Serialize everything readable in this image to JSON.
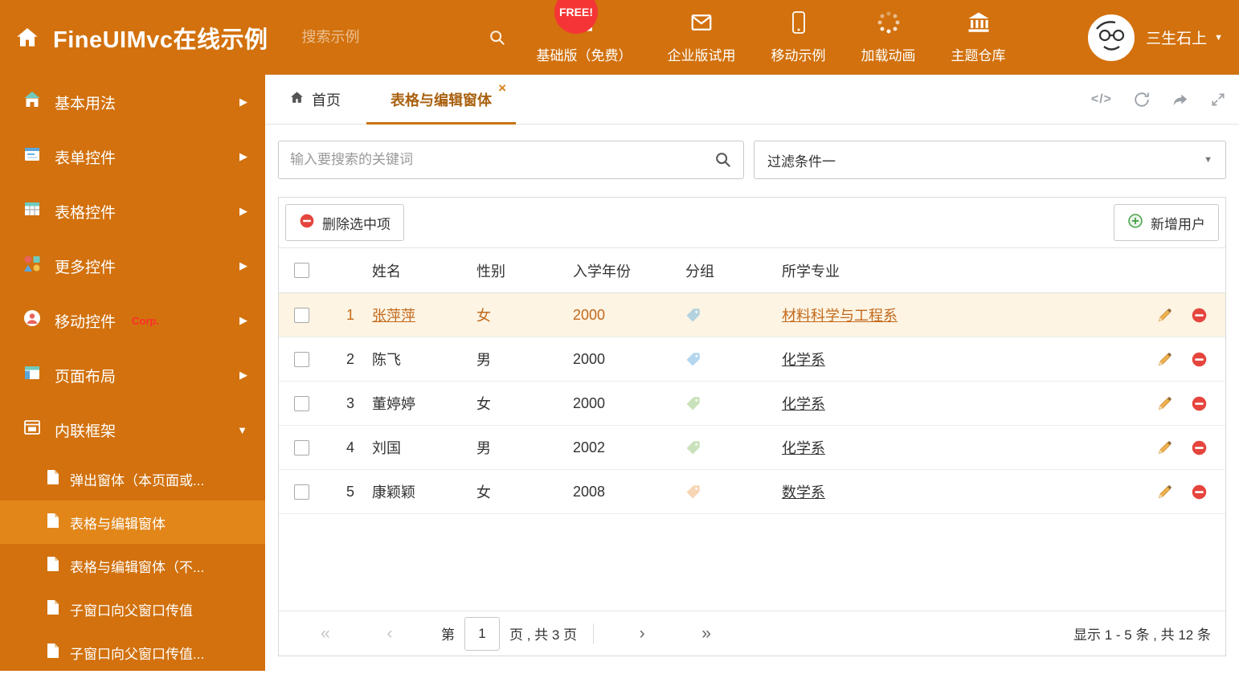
{
  "colors": {
    "primary": "#d2710d",
    "sidebar_active": "#e2861a",
    "selected_row_bg": "#fdf4e3",
    "selected_row_text": "#c2691c",
    "free_badge_bg": "#f53535",
    "tab_underline": "#c9720f"
  },
  "topbar": {
    "title": "FineUIMvc在线示例",
    "search_placeholder": "搜索示例",
    "free_badge": "FREE!",
    "nav": [
      {
        "label": "基础版（免费）",
        "icon": "download-icon"
      },
      {
        "label": "企业版试用",
        "icon": "envelope-icon"
      },
      {
        "label": "移动示例",
        "icon": "mobile-icon"
      },
      {
        "label": "加载动画",
        "icon": "spinner-icon"
      },
      {
        "label": "主题仓库",
        "icon": "bank-icon"
      }
    ],
    "username": "三生石上"
  },
  "sidebar": {
    "items": [
      {
        "label": "基本用法"
      },
      {
        "label": "表单控件"
      },
      {
        "label": "表格控件"
      },
      {
        "label": "更多控件"
      },
      {
        "label": "移动控件",
        "badge": "Corp."
      },
      {
        "label": "页面布局"
      },
      {
        "label": "内联框架"
      }
    ],
    "subitems": [
      {
        "label": "弹出窗体（本页面或..."
      },
      {
        "label": "表格与编辑窗体",
        "active": true
      },
      {
        "label": "表格与编辑窗体（不..."
      },
      {
        "label": "子窗口向父窗口传值"
      },
      {
        "label": "子窗口向父窗口传值..."
      }
    ]
  },
  "tabs": {
    "home": "首页",
    "active": "表格与编辑窗体",
    "close": "×",
    "code_icon_text": "</>"
  },
  "filters": {
    "search_placeholder": "输入要搜索的关键词",
    "dropdown_value": "过滤条件一"
  },
  "grid": {
    "delete_label": "删除选中项",
    "add_label": "新增用户",
    "columns": [
      "姓名",
      "性别",
      "入学年份",
      "分组",
      "所学专业"
    ],
    "rows": [
      {
        "num": "1",
        "name": "张萍萍",
        "gender": "女",
        "year": "2000",
        "tag_color": "#5aa7dc",
        "major": "材料科学与工程系",
        "selected": true
      },
      {
        "num": "2",
        "name": "陈飞",
        "gender": "男",
        "year": "2000",
        "tag_color": "#5aa7dc",
        "major": "化学系",
        "selected": false
      },
      {
        "num": "3",
        "name": "董婷婷",
        "gender": "女",
        "year": "2000",
        "tag_color": "#8bbf6a",
        "major": "化学系",
        "selected": false
      },
      {
        "num": "4",
        "name": "刘国",
        "gender": "男",
        "year": "2002",
        "tag_color": "#8bbf6a",
        "major": "化学系",
        "selected": false
      },
      {
        "num": "5",
        "name": "康颖颖",
        "gender": "女",
        "year": "2008",
        "tag_color": "#efa35c",
        "major": "数学系",
        "selected": false
      }
    ]
  },
  "pager": {
    "first": "«",
    "prev": "‹",
    "page_before": "第",
    "current": "1",
    "page_after": "页 , 共 3 页",
    "next": "›",
    "last": "»",
    "summary": "显示 1 - 5 条 , 共 12 条"
  }
}
